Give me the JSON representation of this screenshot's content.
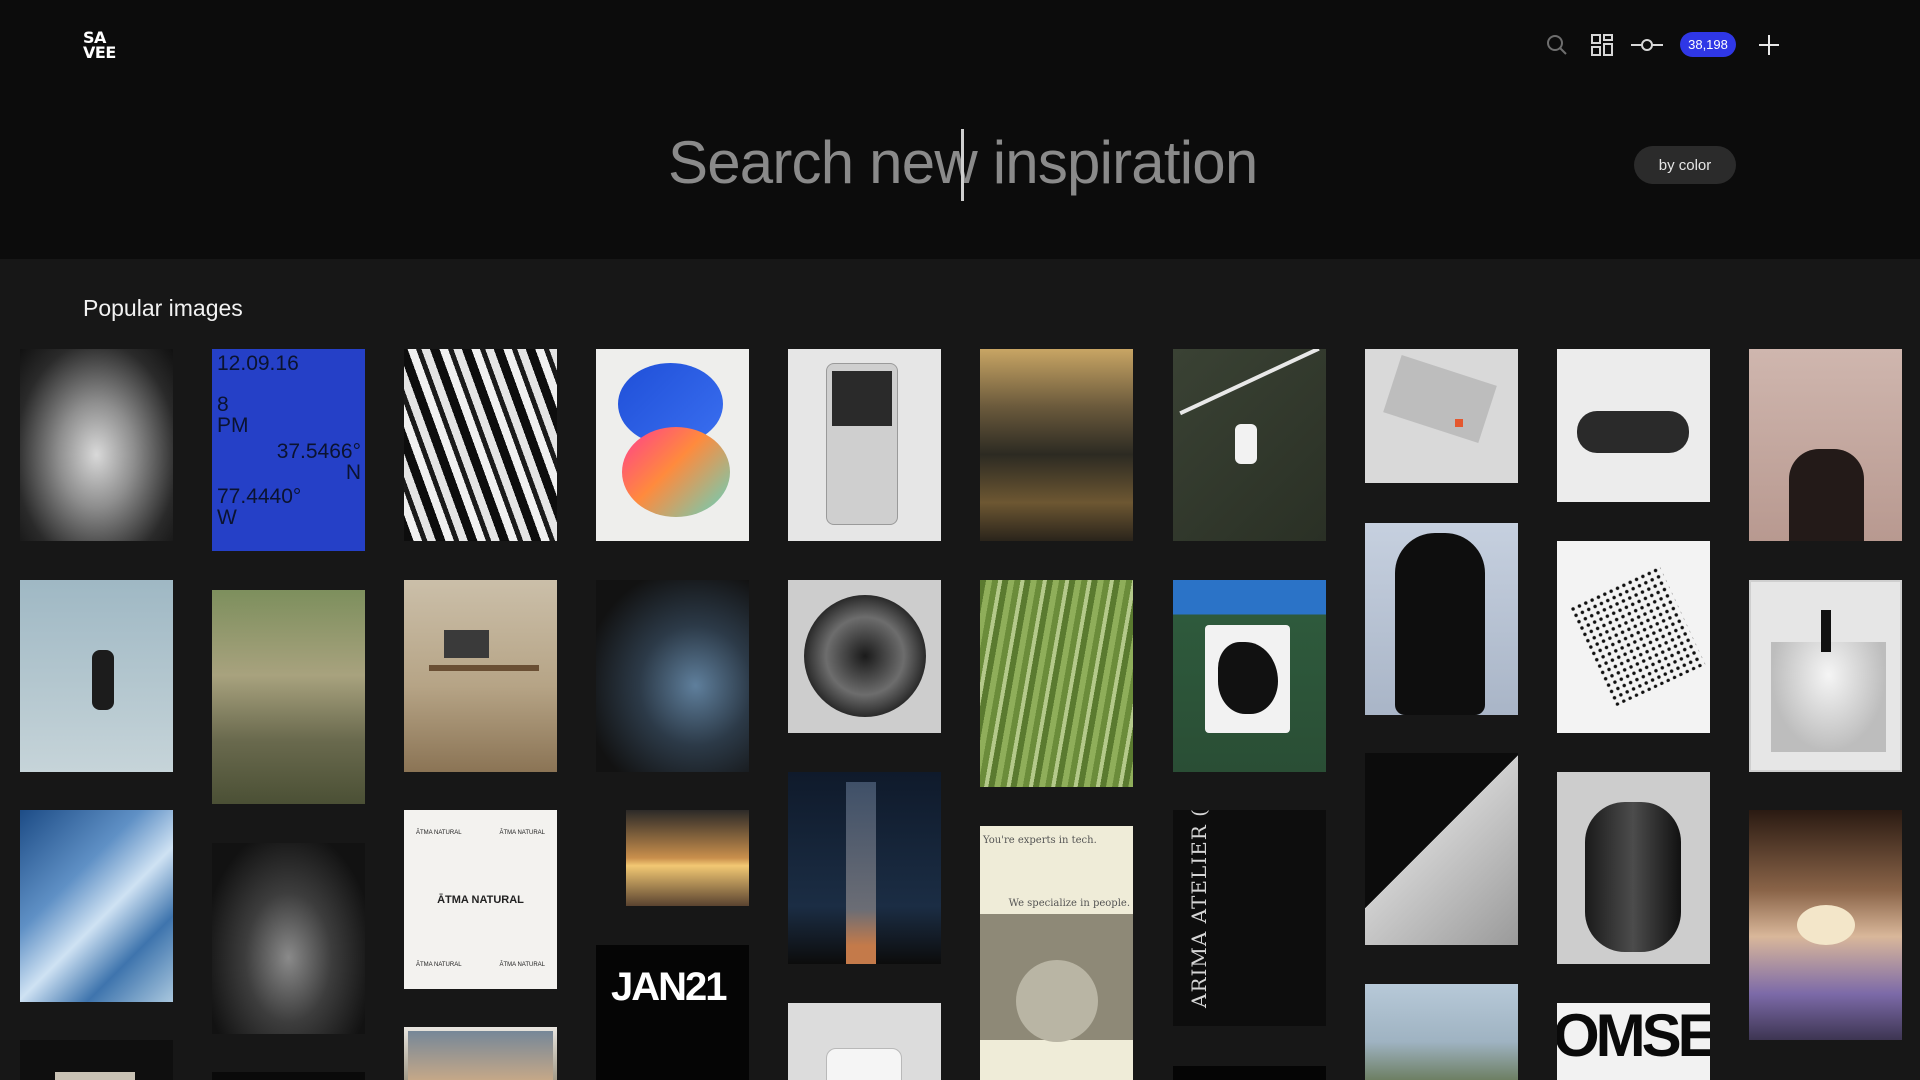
{
  "logo": {
    "line1": "SA",
    "line2": "VEE"
  },
  "toolbar": {
    "search_icon": "search-icon",
    "grid_icon": "grid-layout-icon",
    "slider_icon": "slider-icon",
    "count_badge": "38,198",
    "add_icon": "plus-icon"
  },
  "search": {
    "placeholder": "Search new inspiration",
    "by_color_label": "by color"
  },
  "section": {
    "title": "Popular images"
  },
  "tiles": {
    "date_poster": {
      "date": "12.09.16",
      "time": "8\nPM",
      "lat": "37.5466°\nN",
      "lon": "77.4440°\nW"
    },
    "atma": {
      "brand": "ĀTMA NATURAL"
    },
    "jan": {
      "label": "JAN21"
    },
    "experts": {
      "line1": "You're experts in tech.",
      "line2": "We specialize in people."
    },
    "atelier": {
      "text": "ARIMA ATELIER (R) EMOCIONAL"
    },
    "omse": {
      "text": "OMSE"
    }
  },
  "colors": {
    "accent": "#2f37e6",
    "header_bg": "#0c0c0c",
    "page_bg": "#171717"
  }
}
